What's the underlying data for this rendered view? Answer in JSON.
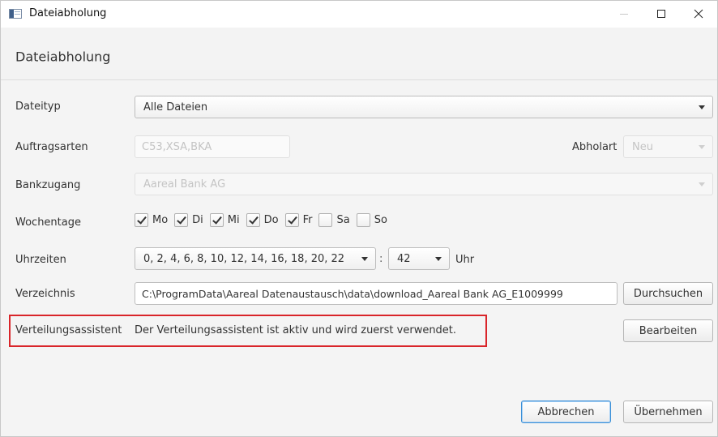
{
  "window": {
    "title": "Dateiabholung",
    "header": "Dateiabholung"
  },
  "form": {
    "dateityp": {
      "label": "Dateityp",
      "value": "Alle Dateien"
    },
    "auftragsarten": {
      "label": "Auftragsarten",
      "value": "C53,XSA,BKA"
    },
    "abholart": {
      "label": "Abholart",
      "value": "Neu"
    },
    "bankzugang": {
      "label": "Bankzugang",
      "value": "Aareal Bank AG"
    },
    "wochentage": {
      "label": "Wochentage",
      "days": [
        {
          "label": "Mo",
          "checked": true
        },
        {
          "label": "Di",
          "checked": true
        },
        {
          "label": "Mi",
          "checked": true
        },
        {
          "label": "Do",
          "checked": true
        },
        {
          "label": "Fr",
          "checked": true
        },
        {
          "label": "Sa",
          "checked": false
        },
        {
          "label": "So",
          "checked": false
        }
      ]
    },
    "uhrzeiten": {
      "label": "Uhrzeiten",
      "hours": "0, 2, 4, 6, 8, 10, 12, 14, 16, 18, 20, 22",
      "separator": ":",
      "minutes": "42",
      "unit": "Uhr"
    },
    "verzeichnis": {
      "label": "Verzeichnis",
      "value": "C:\\ProgramData\\Aareal Datenaustausch\\data\\download_Aareal Bank AG_E1009999",
      "button": "Durchsuchen"
    },
    "verteilung": {
      "label": "Verteilungsassistent",
      "text": "Der Verteilungsassistent ist aktiv und wird zuerst verwendet.",
      "button": "Bearbeiten"
    }
  },
  "footer": {
    "cancel": "Abbrechen",
    "apply": "Übernehmen"
  },
  "colors": {
    "highlight": "#d9252a",
    "default_button_border": "#3a8fd6"
  }
}
